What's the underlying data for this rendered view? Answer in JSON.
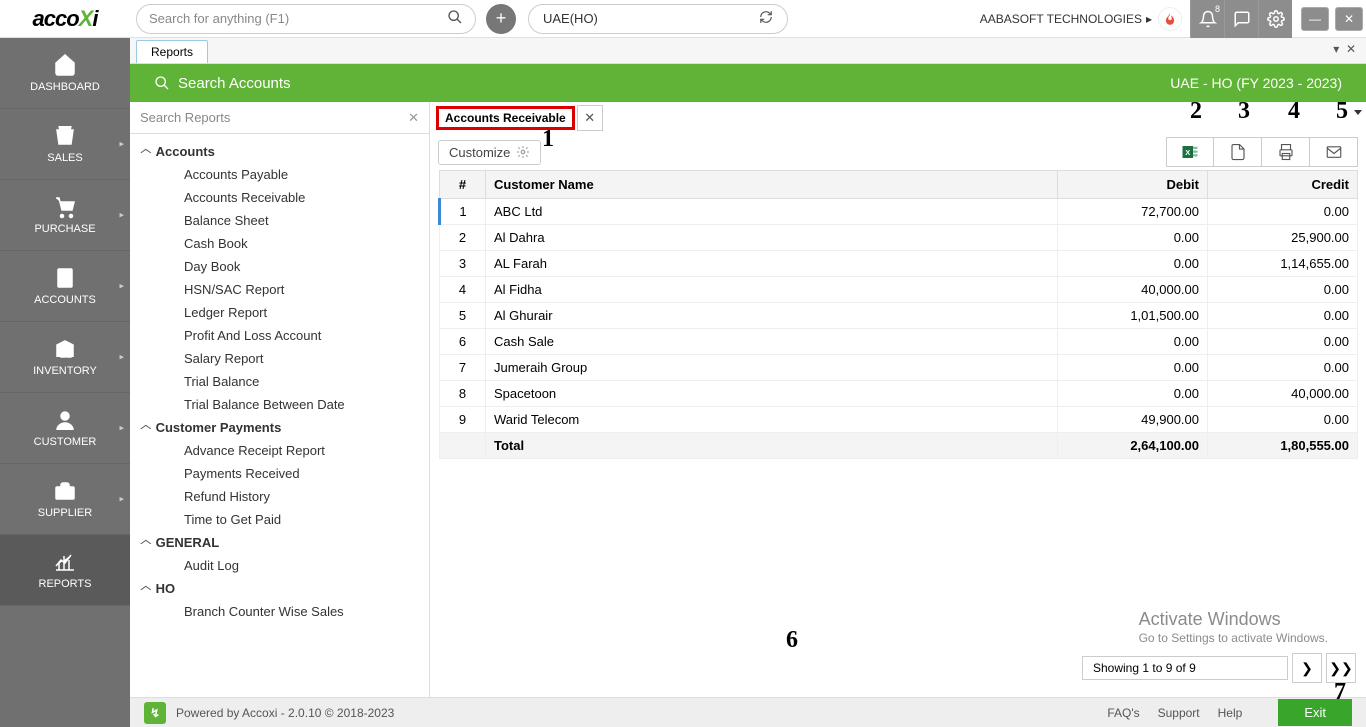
{
  "top": {
    "logo_a": "acco",
    "logo_b": "X",
    "logo_c": "i",
    "search_placeholder": "Search for anything (F1)",
    "branch": "UAE(HO)",
    "company": "AABASOFT TECHNOLOGIES",
    "notif_count": "8"
  },
  "nav": {
    "items": [
      "DASHBOARD",
      "SALES",
      "PURCHASE",
      "ACCOUNTS",
      "INVENTORY",
      "CUSTOMER",
      "SUPPLIER",
      "REPORTS"
    ]
  },
  "tab": "Reports",
  "green": {
    "left": "Search Accounts",
    "right": "UAE - HO (FY 2023 - 2023)"
  },
  "treesearch": "Search Reports",
  "tree": {
    "groups": [
      {
        "name": "Accounts",
        "items": [
          "Accounts Payable",
          "Accounts Receivable",
          "Balance Sheet",
          "Cash Book",
          "Day Book",
          "HSN/SAC Report",
          "Ledger Report",
          "Profit And Loss Account",
          "Salary Report",
          "Trial Balance",
          "Trial Balance Between Date"
        ]
      },
      {
        "name": "Customer Payments",
        "items": [
          "Advance Receipt Report",
          "Payments Received",
          "Refund History",
          "Time to Get Paid"
        ]
      },
      {
        "name": "GENERAL",
        "items": [
          "Audit Log"
        ]
      },
      {
        "name": "HO",
        "items": [
          "Branch Counter Wise Sales"
        ]
      }
    ]
  },
  "report_tab": "Accounts Receivable",
  "customize": "Customize",
  "columns": {
    "idx": "#",
    "name": "Customer Name",
    "debit": "Debit",
    "credit": "Credit"
  },
  "rows": [
    {
      "i": "1",
      "n": "ABC Ltd",
      "d": "72,700.00",
      "c": "0.00"
    },
    {
      "i": "2",
      "n": "Al Dahra",
      "d": "0.00",
      "c": "25,900.00"
    },
    {
      "i": "3",
      "n": "AL Farah",
      "d": "0.00",
      "c": "1,14,655.00"
    },
    {
      "i": "4",
      "n": "Al Fidha",
      "d": "40,000.00",
      "c": "0.00"
    },
    {
      "i": "5",
      "n": "Al Ghurair",
      "d": "1,01,500.00",
      "c": "0.00"
    },
    {
      "i": "6",
      "n": "Cash Sale",
      "d": "0.00",
      "c": "0.00"
    },
    {
      "i": "7",
      "n": "Jumeraih Group",
      "d": "0.00",
      "c": "0.00"
    },
    {
      "i": "8",
      "n": "Spacetoon",
      "d": "0.00",
      "c": "40,000.00"
    },
    {
      "i": "9",
      "n": "Warid Telecom",
      "d": "49,900.00",
      "c": "0.00"
    }
  ],
  "total": {
    "label": "Total",
    "d": "2,64,100.00",
    "c": "1,80,555.00"
  },
  "pager": "Showing 1 to 9 of 9",
  "watermark": {
    "l1": "Activate Windows",
    "l2": "Go to Settings to activate Windows."
  },
  "footer": {
    "powered": "Powered by Accoxi - 2.0.10 © 2018-2023",
    "faq": "FAQ's",
    "support": "Support",
    "help": "Help",
    "exit": "Exit"
  },
  "annot": {
    "a1": "1",
    "a2": "2",
    "a3": "3",
    "a4": "4",
    "a5": "5",
    "a6": "6",
    "a7": "7"
  }
}
